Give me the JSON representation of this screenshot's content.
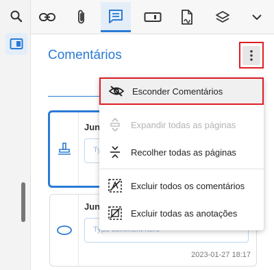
{
  "rail": {
    "items": [
      {
        "icon": "search-icon",
        "active": false
      },
      {
        "icon": "panel-icon",
        "active": true
      }
    ]
  },
  "toolbar": {
    "buttons": [
      {
        "icon": "link-icon",
        "active": false
      },
      {
        "icon": "paperclip-icon",
        "active": false
      },
      {
        "icon": "comment-icon",
        "active": true
      },
      {
        "icon": "form-field-icon",
        "active": false
      },
      {
        "icon": "sign-document-icon",
        "active": false
      },
      {
        "icon": "layers-icon",
        "active": false
      },
      {
        "icon": "chevron-down-icon",
        "active": false
      }
    ]
  },
  "panel": {
    "title": "Comentários"
  },
  "cards": [
    {
      "icon": "stamp-icon",
      "author": "Jun",
      "placeholder": "Typ"
    },
    {
      "icon": "ellipse-icon",
      "author": "Jun",
      "placeholder": "Type comment here",
      "date": "2023-01-27 18:17"
    }
  ],
  "menu": {
    "items": [
      {
        "label": "Esconder Comentários",
        "icon": "eye-off-icon",
        "disabled": false,
        "highlighted": true
      },
      {
        "label": "Expandir todas as páginas",
        "icon": "expand-icon",
        "disabled": true
      },
      {
        "label": "Recolher todas as páginas",
        "icon": "collapse-icon",
        "disabled": false
      },
      {
        "label": "Excluir todos os comentários",
        "icon": "delete-comments-icon",
        "disabled": false
      },
      {
        "label": "Excluir todas as anotações",
        "icon": "delete-annotations-icon",
        "disabled": false
      }
    ]
  },
  "colors": {
    "accent": "#2a7ad4",
    "highlight": "#e01b24"
  }
}
